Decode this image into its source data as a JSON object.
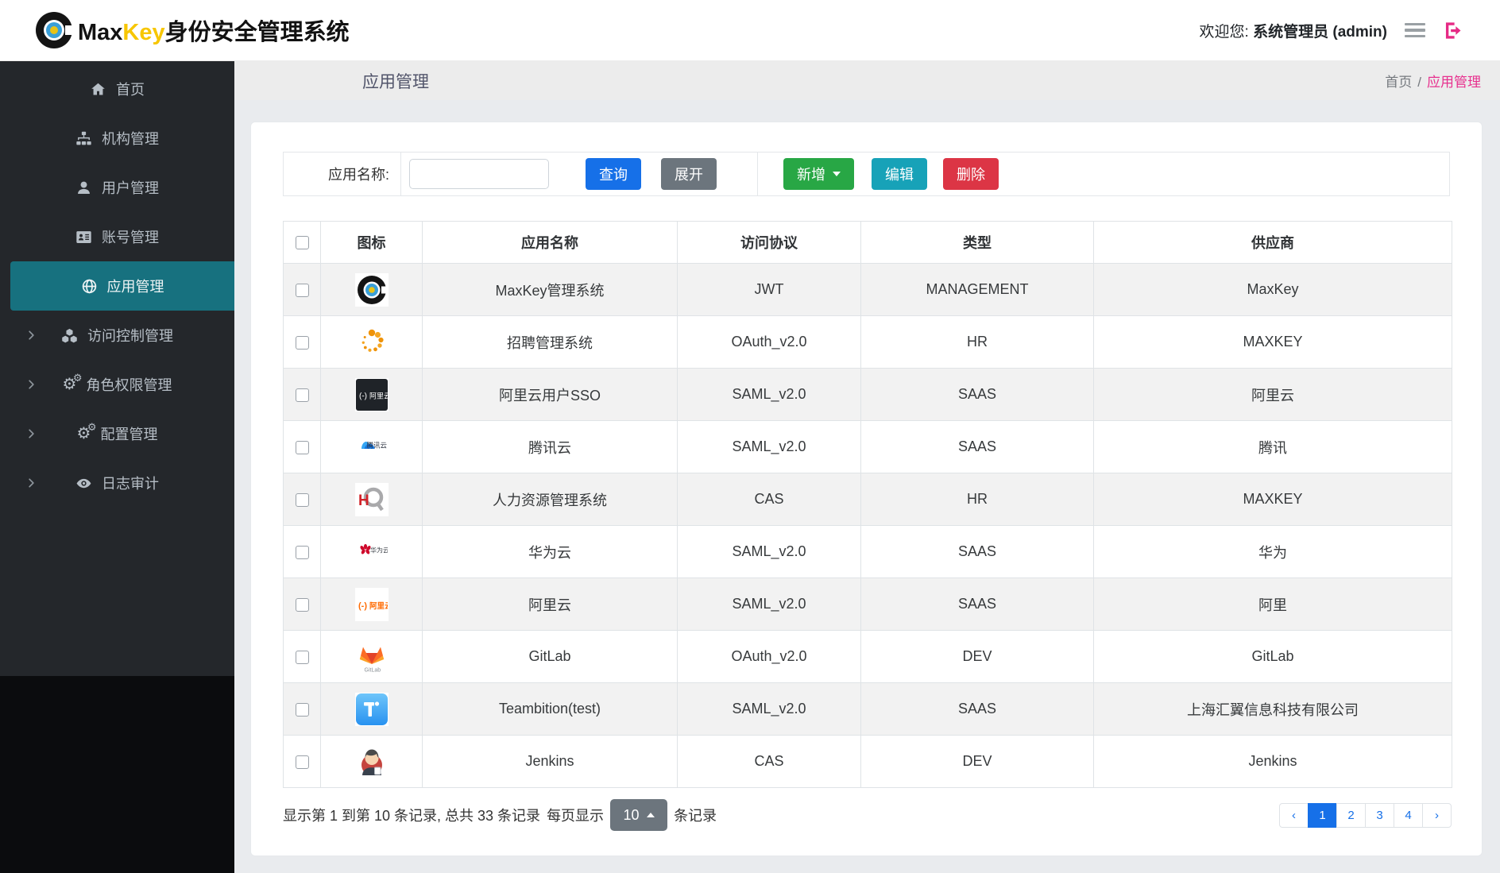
{
  "app": {
    "brand": {
      "name_black": "Max",
      "name_yellow": "Key",
      "title_suffix": "身份安全管理系统"
    },
    "header": {
      "welcome_prefix": "欢迎您:",
      "username": "系统管理员 (admin)"
    }
  },
  "colors": {
    "sidebar_active": "#17717f",
    "brand_yellow": "#f7c600",
    "breadcrumb_active": "#e7308e",
    "query_button": "#1670e8",
    "expand_button": "#6c757d",
    "add_button": "#28a745",
    "edit_button": "#17a2b8",
    "delete_button": "#dc3545",
    "pagination_active": "#1670e8"
  },
  "sidebar": {
    "items": [
      {
        "key": "home",
        "label": "首页",
        "icon": "home",
        "expandable": false,
        "active": false
      },
      {
        "key": "org",
        "label": "机构管理",
        "icon": "sitemap",
        "expandable": false,
        "active": false
      },
      {
        "key": "users",
        "label": "用户管理",
        "icon": "user",
        "expandable": false,
        "active": false
      },
      {
        "key": "accounts",
        "label": "账号管理",
        "icon": "id-card",
        "expandable": false,
        "active": false
      },
      {
        "key": "apps",
        "label": "应用管理",
        "icon": "globe",
        "expandable": false,
        "active": true
      },
      {
        "key": "access",
        "label": "访问控制管理",
        "icon": "cubes",
        "expandable": true,
        "active": false
      },
      {
        "key": "roles",
        "label": "角色权限管理",
        "icon": "cogs",
        "expandable": true,
        "active": false
      },
      {
        "key": "config",
        "label": "配置管理",
        "icon": "cogs",
        "expandable": true,
        "active": false
      },
      {
        "key": "audit",
        "label": "日志审计",
        "icon": "eye",
        "expandable": true,
        "active": false
      }
    ]
  },
  "page": {
    "title": "应用管理",
    "breadcrumb": {
      "root": "首页",
      "separator": "/",
      "current": "应用管理"
    }
  },
  "toolbar": {
    "search_label": "应用名称:",
    "search_value": "",
    "buttons": {
      "query": "查询",
      "expand": "展开",
      "add": "新增",
      "edit": "编辑",
      "delete": "删除"
    }
  },
  "table": {
    "columns": [
      "图标",
      "应用名称",
      "访问协议",
      "类型",
      "供应商"
    ],
    "rows": [
      {
        "icon": "maxkey-logo",
        "name": "MaxKey管理系统",
        "protocol": "JWT",
        "type": "MANAGEMENT",
        "vendor": "MaxKey"
      },
      {
        "icon": "dots-spinner",
        "name": "招聘管理系统",
        "protocol": "OAuth_v2.0",
        "type": "HR",
        "vendor": "MAXKEY"
      },
      {
        "icon": "aliyun-dark",
        "name": "阿里云用户SSO",
        "protocol": "SAML_v2.0",
        "type": "SAAS",
        "vendor": "阿里云"
      },
      {
        "icon": "tencent-cloud",
        "name": "腾讯云",
        "protocol": "SAML_v2.0",
        "type": "SAAS",
        "vendor": "腾讯"
      },
      {
        "icon": "hr-logo",
        "name": "人力资源管理系统",
        "protocol": "CAS",
        "type": "HR",
        "vendor": "MAXKEY"
      },
      {
        "icon": "huawei-cloud",
        "name": "华为云",
        "protocol": "SAML_v2.0",
        "type": "SAAS",
        "vendor": "华为"
      },
      {
        "icon": "aliyun-light",
        "name": "阿里云",
        "protocol": "SAML_v2.0",
        "type": "SAAS",
        "vendor": "阿里"
      },
      {
        "icon": "gitlab",
        "name": "GitLab",
        "protocol": "OAuth_v2.0",
        "type": "DEV",
        "vendor": "GitLab"
      },
      {
        "icon": "teambition",
        "name": "Teambition(test)",
        "protocol": "SAML_v2.0",
        "type": "SAAS",
        "vendor": "上海汇翼信息科技有限公司"
      },
      {
        "icon": "jenkins",
        "name": "Jenkins",
        "protocol": "CAS",
        "type": "DEV",
        "vendor": "Jenkins"
      }
    ]
  },
  "footer": {
    "summary": "显示第 1 到第 10 条记录, 总共 33 条记录",
    "per_page_prefix": "每页显示",
    "page_size": "10",
    "per_page_suffix": "条记录",
    "pagination": {
      "prev": "‹",
      "pages": [
        "1",
        "2",
        "3",
        "4"
      ],
      "active_page": "1",
      "next": "›"
    }
  }
}
